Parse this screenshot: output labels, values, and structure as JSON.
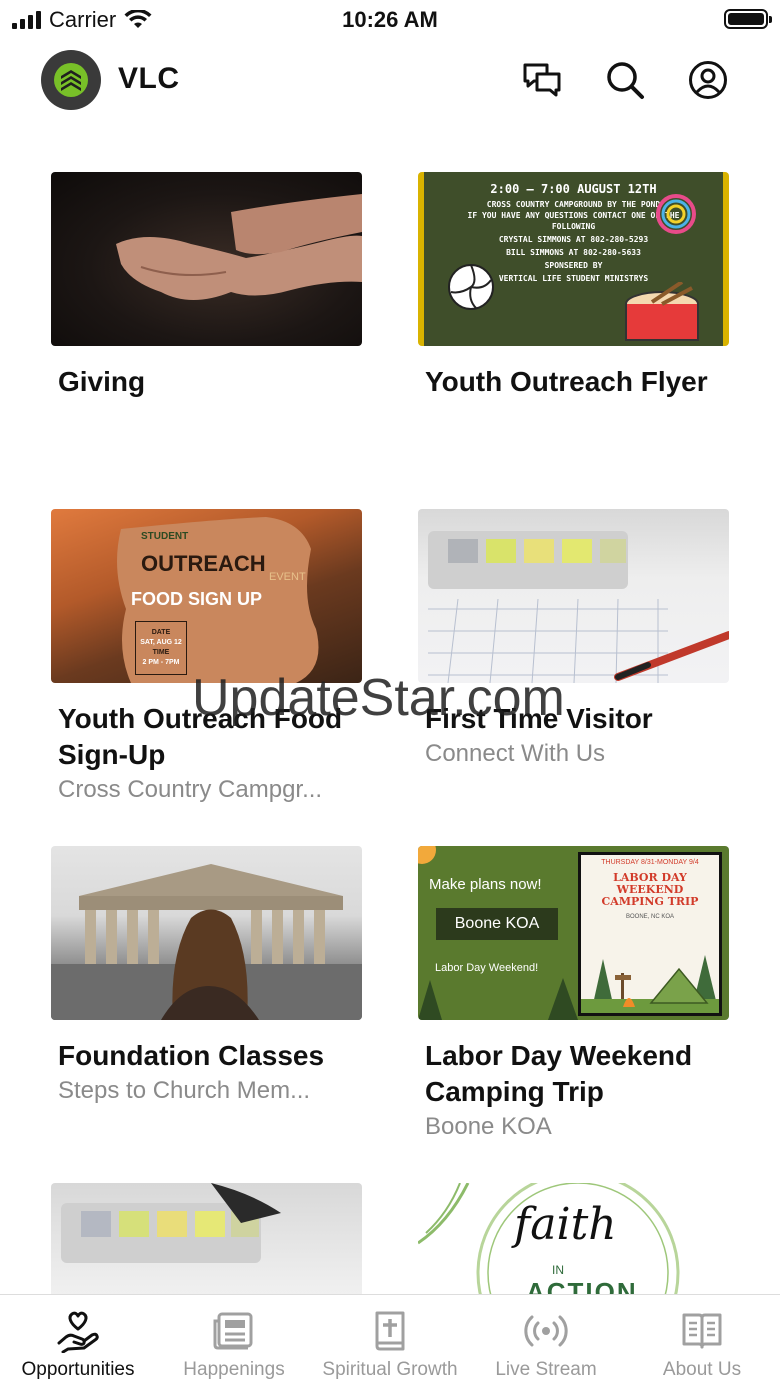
{
  "status_bar": {
    "carrier": "Carrier",
    "time": "10:26 AM"
  },
  "header": {
    "title": "VLC"
  },
  "cards": [
    {
      "title": "Giving",
      "subtitle": ""
    },
    {
      "title": "Youth Outreach Flyer",
      "subtitle": "",
      "image_text": [
        "2:00 – 7:00 AUGUST 12TH",
        "CROSS COUNTRY CAMPGROUND BY THE POND",
        "IF YOU HAVE ANY QUESTIONS CONTACT ONE OF THE",
        "FOLLOWING",
        "CRYSTAL SIMMONS AT 802-280-5293",
        "BILL SIMMONS AT 802-280-5633",
        "SPONSERED BY",
        "VERTICAL LIFE STUDENT MINISTRYS"
      ]
    },
    {
      "title": "Youth Outreach Food Sign-Up",
      "subtitle": "Cross Country Campgr...",
      "image_text": {
        "brand": "STUDENT",
        "headline": "OUTREACH",
        "tag": "EVENT",
        "sub": "FOOD SIGN UP",
        "date_label": "DATE",
        "date": "SAT, AUG 12",
        "time_label": "TIME",
        "time": "2 PM - 7PM"
      }
    },
    {
      "title": "First Time Visitor",
      "subtitle": "Connect With Us"
    },
    {
      "title": "Foundation Classes",
      "subtitle": "Steps to Church Mem..."
    },
    {
      "title": "Labor Day Weekend Camping Trip",
      "subtitle": "Boone KOA",
      "image_text": {
        "line1": "Make plans now!",
        "box": "Boone KOA",
        "line3": "Labor Day Weekend!",
        "poster_date": "THURSDAY 8/31-MONDAY 9/4",
        "poster_title": "LABOR DAY WEEKEND CAMPING TRIP",
        "poster_loc": "BOONE, NC KOA"
      }
    },
    {
      "title": "",
      "subtitle": ""
    },
    {
      "title": "",
      "subtitle": "",
      "image_text": {
        "script": "faith",
        "in": "IN",
        "action": "ACTION"
      }
    }
  ],
  "watermark": "UpdateStar.com",
  "tabs": [
    {
      "label": "Opportunities",
      "icon": "hand-heart-icon",
      "active": true
    },
    {
      "label": "Happenings",
      "icon": "newspaper-icon",
      "active": false
    },
    {
      "label": "Spiritual Growth",
      "icon": "bible-icon",
      "active": false
    },
    {
      "label": "Live Stream",
      "icon": "broadcast-icon",
      "active": false
    },
    {
      "label": "About Us",
      "icon": "open-book-icon",
      "active": false
    }
  ]
}
